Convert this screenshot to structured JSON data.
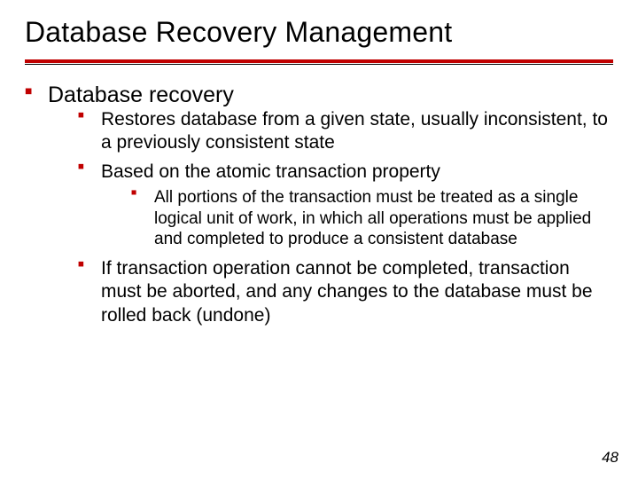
{
  "title": "Database Recovery Management",
  "page_number": "48",
  "points": {
    "l1": "Database recovery",
    "l2a": "Restores database from a given state, usually inconsistent, to a previously consistent state",
    "l2b": "Based on the atomic transaction property",
    "l3a": "All portions of the transaction must be treated as a single logical unit of work, in which all operations must be applied and completed to produce a consistent database",
    "l2c": "If transaction operation cannot be completed, transaction must be aborted, and any changes to the database must be rolled back (undone)"
  }
}
